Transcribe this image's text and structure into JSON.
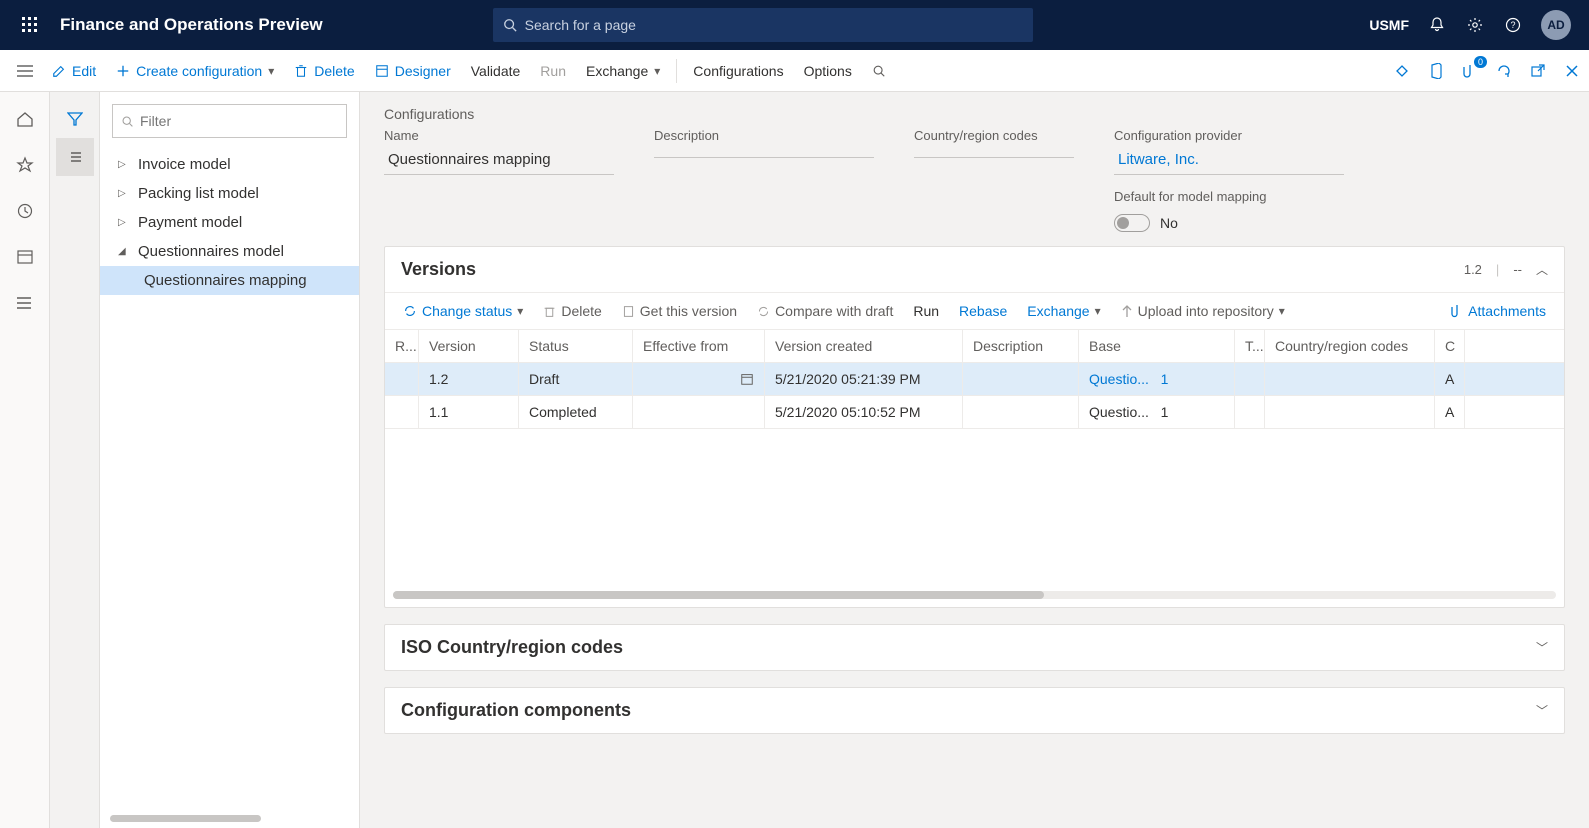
{
  "topbar": {
    "title": "Finance and Operations Preview",
    "search_placeholder": "Search for a page",
    "company": "USMF",
    "avatar": "AD"
  },
  "cmdbar": {
    "edit": "Edit",
    "create": "Create configuration",
    "delete": "Delete",
    "designer": "Designer",
    "validate": "Validate",
    "run": "Run",
    "exchange": "Exchange",
    "configurations": "Configurations",
    "options": "Options",
    "attach_badge": "0"
  },
  "tree": {
    "filter_placeholder": "Filter",
    "items": [
      {
        "label": "Invoice model",
        "expanded": false
      },
      {
        "label": "Packing list model",
        "expanded": false
      },
      {
        "label": "Payment model",
        "expanded": false
      },
      {
        "label": "Questionnaires model",
        "expanded": true,
        "children": [
          {
            "label": "Questionnaires mapping",
            "selected": true
          }
        ]
      }
    ]
  },
  "header": {
    "breadcrumb": "Configurations",
    "labels": {
      "name": "Name",
      "desc": "Description",
      "crc": "Country/region codes",
      "provider": "Configuration provider",
      "default": "Default for model mapping"
    },
    "name": "Questionnaires mapping",
    "desc": "",
    "crc": "",
    "provider": "Litware, Inc.",
    "default_text": "No"
  },
  "versions": {
    "title": "Versions",
    "current": "1.2",
    "extra": "--",
    "toolbar": {
      "change_status": "Change status",
      "delete": "Delete",
      "get_version": "Get this version",
      "compare": "Compare with draft",
      "run": "Run",
      "rebase": "Rebase",
      "exchange": "Exchange",
      "upload": "Upload into repository",
      "attachments": "Attachments"
    },
    "columns": {
      "r": "R...",
      "version": "Version",
      "status": "Status",
      "eff": "Effective from",
      "created": "Version created",
      "desc": "Description",
      "base": "Base",
      "t": "T...",
      "crc": "Country/region codes",
      "cr": "C"
    },
    "rows": [
      {
        "version": "1.2",
        "status": "Draft",
        "eff": "",
        "created": "5/21/2020 05:21:39 PM",
        "desc": "",
        "base": "Questio...",
        "base_n": "1",
        "t": "",
        "crc": "",
        "cr": "A",
        "selected": true
      },
      {
        "version": "1.1",
        "status": "Completed",
        "eff": "",
        "created": "5/21/2020 05:10:52 PM",
        "desc": "",
        "base": "Questio...",
        "base_n": "1",
        "t": "",
        "crc": "",
        "cr": "A",
        "selected": false
      }
    ]
  },
  "sections": {
    "iso": "ISO Country/region codes",
    "components": "Configuration components"
  }
}
